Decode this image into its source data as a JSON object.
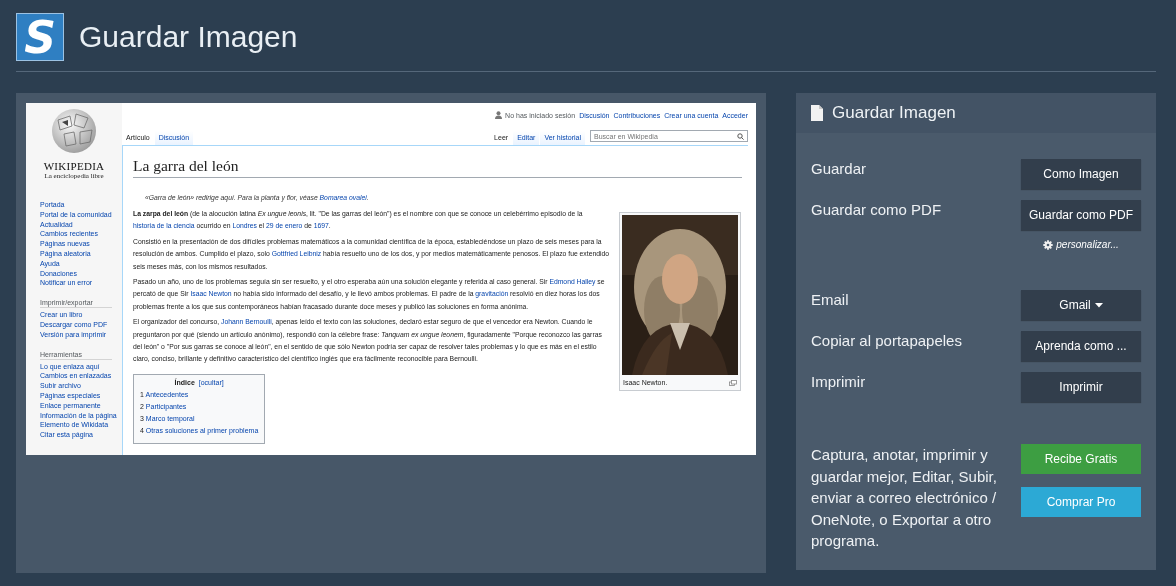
{
  "header": {
    "logo_letter": "S",
    "title": "Guardar Imagen"
  },
  "preview": {
    "wordmark": "WIKIPEDIA",
    "tagline": "La enciclopedia libre",
    "sidebar": [
      {
        "items": [
          "Portada",
          "Portal de la comunidad",
          "Actualidad",
          "Cambios recientes",
          "Páginas nuevas",
          "Página aleatoria",
          "Ayuda",
          "Donaciones",
          "Notificar un error"
        ]
      },
      {
        "heading": "Imprimir/exportar",
        "items": [
          "Crear un libro",
          "Descargar como PDF",
          "Versión para imprimir"
        ]
      },
      {
        "heading": "Herramientas",
        "items": [
          "Lo que enlaza aquí",
          "Cambios en enlazadas",
          "Subir archivo",
          "Páginas especiales",
          "Enlace permanente",
          "Información de la página",
          "Elemento de Wikidata",
          "Citar esta página"
        ]
      }
    ],
    "personal": [
      {
        "kind": "status",
        "text": "No has iniciado sesión"
      },
      {
        "kind": "link",
        "text": "Discusión"
      },
      {
        "kind": "link",
        "text": "Contribuciones"
      },
      {
        "kind": "link",
        "text": "Crear una cuenta"
      },
      {
        "kind": "link",
        "text": "Acceder"
      }
    ],
    "tabs_left": [
      {
        "label": "Artículo",
        "selected": true
      },
      {
        "label": "Discusión",
        "selected": false
      }
    ],
    "tabs_right": [
      {
        "label": "Leer",
        "selected": true
      },
      {
        "label": "Editar",
        "selected": false
      },
      {
        "label": "Ver historial",
        "selected": false
      }
    ],
    "search": {
      "placeholder": "Buscar en Wikipedia"
    },
    "title": "La garra del león",
    "hatnote": [
      {
        "kind": "text",
        "text": "«Garra de león» redirige aquí. Para la planta y flor, véase "
      },
      {
        "kind": "link",
        "text": "Bomarea ovalei"
      },
      {
        "kind": "text",
        "text": "."
      }
    ],
    "paragraphs": [
      [
        {
          "kind": "text",
          "text": "**La zarpa del león** (de la alocución latina *Ex ungue leonis*, lit. \"De las garras del león\") es el nombre con que se conoce un celebérrimo episodio de la "
        },
        {
          "kind": "link",
          "text": "historia de la ciencia"
        },
        {
          "kind": "text",
          "text": " ocurrido en "
        },
        {
          "kind": "link",
          "text": "Londres"
        },
        {
          "kind": "text",
          "text": " el "
        },
        {
          "kind": "link",
          "text": "29 de enero"
        },
        {
          "kind": "text",
          "text": " de "
        },
        {
          "kind": "link",
          "text": "1697"
        },
        {
          "kind": "text",
          "text": "."
        }
      ],
      [
        {
          "kind": "text",
          "text": "Consistió en la presentación de dos difíciles problemas matemáticos a la comunidad científica de la época, estableciéndose un plazo de seis meses para la resolución de ambos. Cumplido el plazo, solo "
        },
        {
          "kind": "link",
          "text": "Gottfried Leibniz"
        },
        {
          "kind": "text",
          "text": " había resuelto uno de los dos, y por medios matemáticamente penosos. El plazo fue extendido seis meses más, con los mismos resultados."
        }
      ],
      [
        {
          "kind": "text",
          "text": "Pasado un año, uno de los problemas seguía sin ser resuelto, y el otro esperaba aún una solución elegante y referida al caso general. Sir "
        },
        {
          "kind": "link",
          "text": "Edmond Halley"
        },
        {
          "kind": "text",
          "text": " se percató de que Sir "
        },
        {
          "kind": "link",
          "text": "Isaac Newton"
        },
        {
          "kind": "text",
          "text": " no había sido informado del desafío, y le llevó ambos problemas. El padre de la "
        },
        {
          "kind": "link",
          "text": "gravitación"
        },
        {
          "kind": "text",
          "text": " resolvió en diez horas los dos problemas frente a los que sus contemporáneos habían fracasado durante doce meses y publicó las soluciones en forma anónima."
        }
      ],
      [
        {
          "kind": "text",
          "text": "El organizador del concurso, "
        },
        {
          "kind": "link",
          "text": "Johann Bernoulli"
        },
        {
          "kind": "text",
          "text": ", apenas leído el texto con las soluciones, declaró estar seguro de que el vencedor era Newton. Cuando le preguntaron por qué (siendo un artículo anónimo), respondió con la célebre frase: *Tanquam ex ungue leonem*, figuradamente \"Porque reconozco las garras del león\" o \"Por sus garras se conoce al león\", en el sentido de que sólo Newton podría ser capaz de resolver tales problemas y lo que es más en el estilo claro, conciso, brillante y definitivo característico del científico inglés que era fácilmente reconocible para Bernoulli."
        }
      ]
    ],
    "figure": {
      "kind": "picture",
      "caption": "Isaac Newton."
    },
    "toc": {
      "title": "Índice",
      "toggle": "[ocultar]",
      "items": [
        {
          "number": "1",
          "label": "Antecedentes"
        },
        {
          "number": "2",
          "label": "Participantes"
        },
        {
          "number": "3",
          "label": "Marco temporal"
        },
        {
          "number": "4",
          "label": "Otras soluciones al primer problema"
        }
      ]
    }
  },
  "panel": {
    "title": "Guardar Imagen",
    "groups": [
      [
        {
          "label": "Guardar",
          "button": "Como Imagen",
          "dropdown": false
        },
        {
          "label": "Guardar como PDF",
          "button": "Guardar como PDF",
          "dropdown": false,
          "link": "personalizar..."
        }
      ],
      [
        {
          "label": "Email",
          "button": "Gmail",
          "dropdown": true
        },
        {
          "label": "Copiar al portapapeles",
          "button": "Aprenda como ...",
          "dropdown": false
        },
        {
          "label": "Imprimir",
          "button": "Imprimir",
          "dropdown": false
        }
      ]
    ],
    "promo": {
      "text": "Captura, anotar, imprimir y guardar mejor, Editar, Subir, enviar a correo electrónico / OneNote, o Exportar a otro programa.",
      "buttons": [
        {
          "label": "Recibe Gratis",
          "kind": "green"
        },
        {
          "label": "Comprar Pro",
          "kind": "blue"
        }
      ]
    }
  }
}
